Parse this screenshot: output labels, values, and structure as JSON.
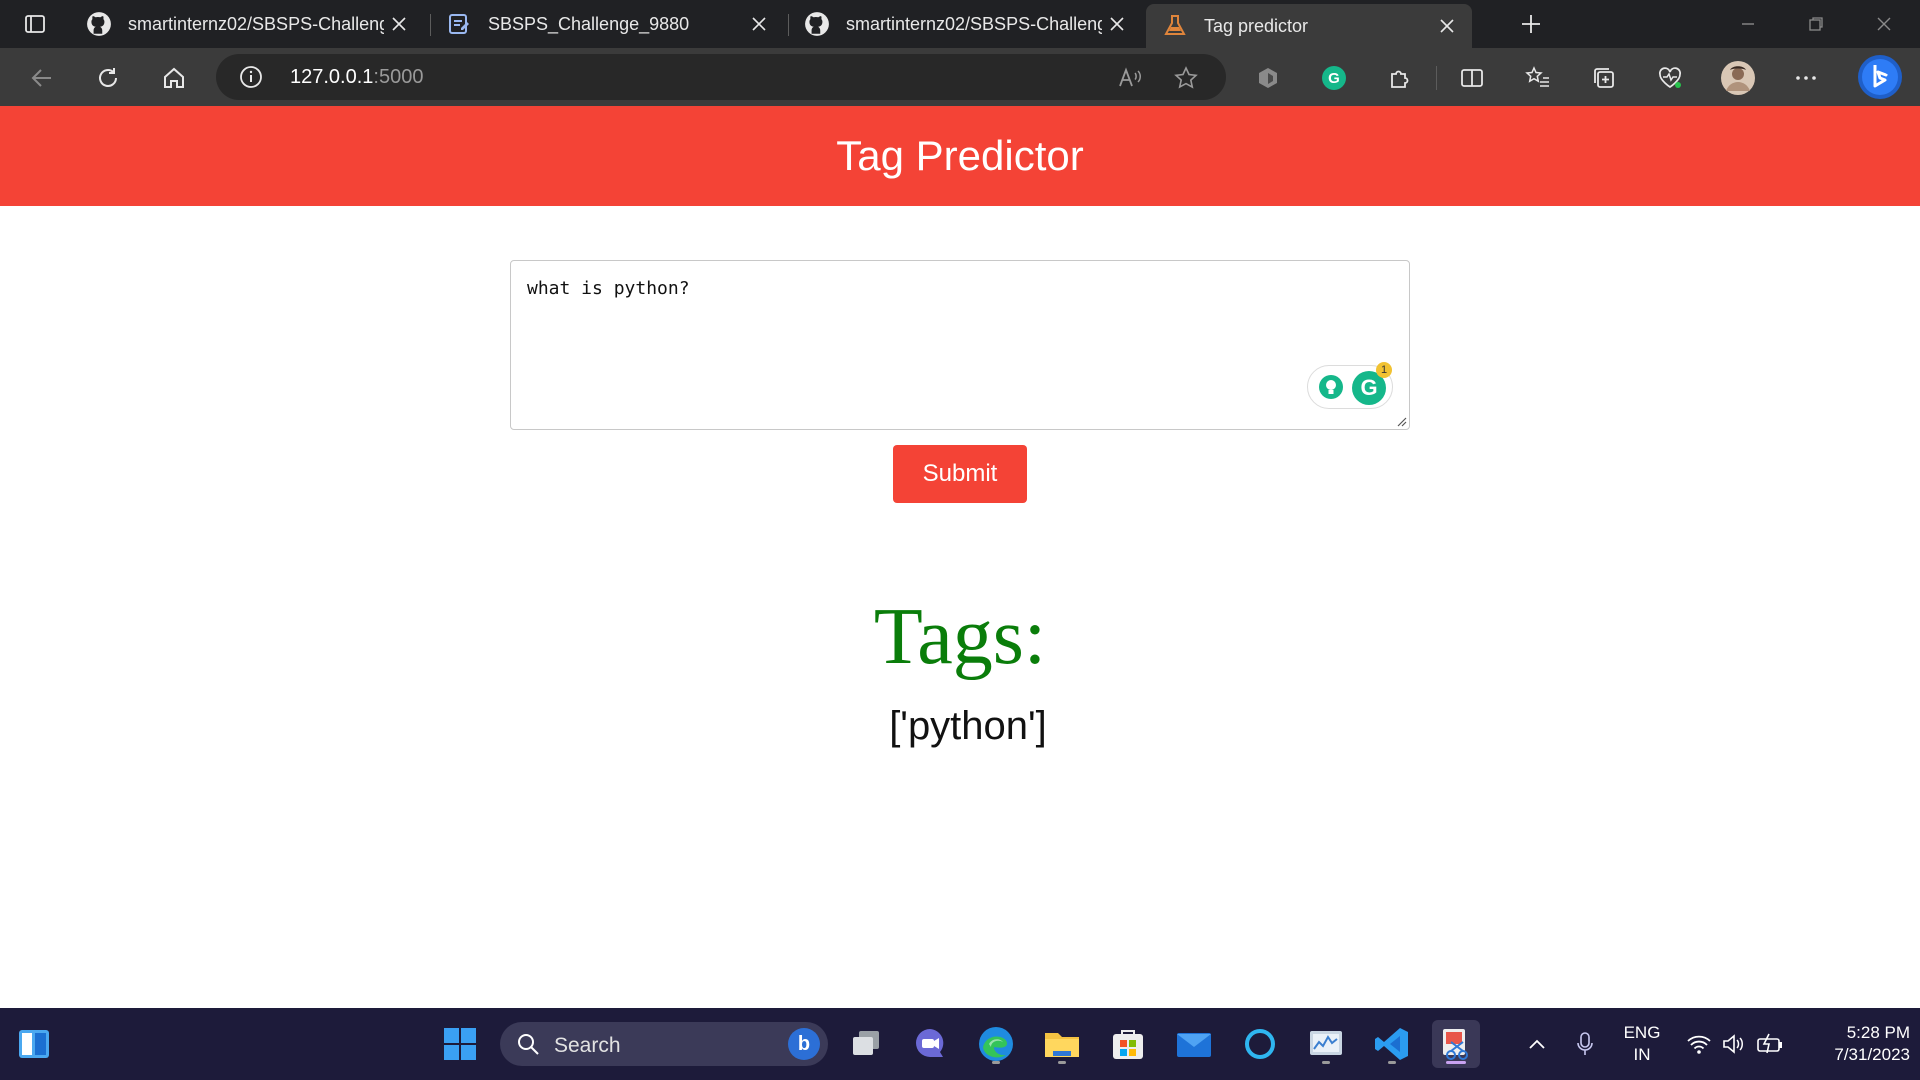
{
  "browser": {
    "tabs": [
      {
        "title": "smartinternz02/SBSPS-Challenge",
        "icon": "github-icon",
        "active": false
      },
      {
        "title": "SBSPS_Challenge_9880",
        "icon": "document-icon",
        "active": false
      },
      {
        "title": "smartinternz02/SBSPS-Challenge",
        "icon": "github-icon",
        "active": false
      },
      {
        "title": "Tag predictor",
        "icon": "flask-icon",
        "active": true
      }
    ],
    "address": {
      "host": "127.0.0.1",
      "port": ":5000"
    }
  },
  "page": {
    "header_title": "Tag Predictor",
    "question_text": "what is python?",
    "grammarly_badge": "1",
    "submit_label": "Submit",
    "tags_heading": "Tags:",
    "tags_value": "['python']"
  },
  "colors": {
    "header_red": "#f44336",
    "tags_green": "#0a7d0a",
    "tab_bg": "#202124",
    "toolbar_bg": "#3b3b3b",
    "taskbar_bg": "#1d1b3a"
  },
  "taskbar": {
    "search_label": "Search",
    "language_line1": "ENG",
    "language_line2": "IN",
    "time": "5:28 PM",
    "date": "7/31/2023"
  }
}
